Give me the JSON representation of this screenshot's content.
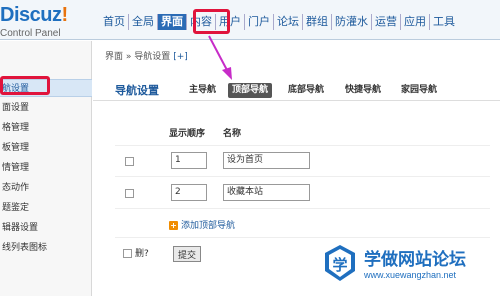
{
  "logo": {
    "title": "Discuz",
    "title_mark": "!",
    "subtitle": "Control Panel"
  },
  "topnav": {
    "items": [
      {
        "label": "首页",
        "active": false
      },
      {
        "label": "全局",
        "active": false
      },
      {
        "label": "界面",
        "active": true
      },
      {
        "label": "内容",
        "active": false
      },
      {
        "label": "用户",
        "active": false
      },
      {
        "label": "门户",
        "active": false
      },
      {
        "label": "论坛",
        "active": false
      },
      {
        "label": "群组",
        "active": false
      },
      {
        "label": "防灌水",
        "active": false
      },
      {
        "label": "运营",
        "active": false
      },
      {
        "label": "应用",
        "active": false
      },
      {
        "label": "工具",
        "active": false
      }
    ]
  },
  "sidebar": {
    "items": [
      {
        "label": "航设置",
        "active": true
      },
      {
        "label": "面设置",
        "active": false
      },
      {
        "label": "格管理",
        "active": false
      },
      {
        "label": "板管理",
        "active": false
      },
      {
        "label": "情管理",
        "active": false
      },
      {
        "label": "态动作",
        "active": false
      },
      {
        "label": "题鉴定",
        "active": false
      },
      {
        "label": "辑器设置",
        "active": false
      },
      {
        "label": "线列表图标",
        "active": false
      }
    ]
  },
  "breadcrumb": {
    "text": "界面 » 导航设置",
    "plus": "[+]"
  },
  "section": {
    "title": "导航设置",
    "tabs": [
      {
        "label": "主导航",
        "active": false
      },
      {
        "label": "顶部导航",
        "active": true
      },
      {
        "label": "底部导航",
        "active": false
      },
      {
        "label": "快捷导航",
        "active": false
      },
      {
        "label": "家园导航",
        "active": false
      }
    ]
  },
  "table": {
    "headers": {
      "order": "显示顺序",
      "name": "名称"
    },
    "rows": [
      {
        "order": "1",
        "name": "设为首页"
      },
      {
        "order": "2",
        "name": "收藏本站"
      }
    ]
  },
  "add_link": "添加顶部导航",
  "delete_label": "删?",
  "submit_label": "提交",
  "watermark": {
    "title": "学做网站论坛",
    "url": "www.xuewangzhan.net"
  },
  "colors": {
    "accent": "#2b6bb5",
    "annotation": "#e0143c",
    "arrow": "#c72cc8"
  }
}
